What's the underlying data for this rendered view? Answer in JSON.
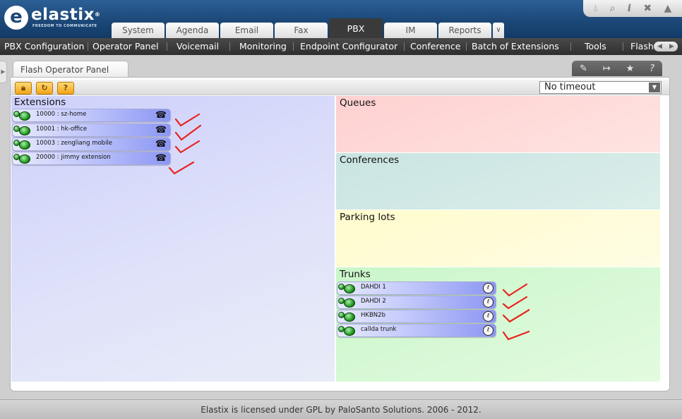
{
  "brand": {
    "logo_mark": "e",
    "name": "elastix",
    "registered": "®",
    "tagline": "FREEDOM TO COMMUNICATE"
  },
  "top_icons": [
    "drop-icon",
    "search-icon",
    "info-icon",
    "puzzle-icon",
    "user-icon"
  ],
  "tabs": [
    {
      "label": "System",
      "active": false
    },
    {
      "label": "Agenda",
      "active": false
    },
    {
      "label": "Email",
      "active": false
    },
    {
      "label": "Fax",
      "active": false
    },
    {
      "label": "PBX",
      "active": true
    },
    {
      "label": "IM",
      "active": false
    },
    {
      "label": "Reports",
      "active": false
    }
  ],
  "subnav": [
    "PBX Configuration",
    "Operator Panel",
    "Voicemail",
    "Monitoring",
    "Endpoint Configurator",
    "Conference",
    "Batch of Extensions",
    "Tools",
    "Flash"
  ],
  "module": {
    "title": "Flash Operator Panel"
  },
  "toolbar": {
    "timeout_value": "No timeout"
  },
  "panels": {
    "extensions": {
      "title": "Extensions",
      "items": [
        "10000 : sz-home",
        "10001 : hk-office",
        "10003 : zengliang mobile",
        "20000 : jimmy extension"
      ]
    },
    "queues": {
      "title": "Queues"
    },
    "conferences": {
      "title": "Conferences"
    },
    "parking": {
      "title": "Parking lots"
    },
    "trunks": {
      "title": "Trunks",
      "items": [
        "DAHDI 1",
        "DAHDI 2",
        "HKBN2b",
        "callda trunk"
      ]
    }
  },
  "annotation_color": "#e8231d",
  "footer": {
    "text": "Elastix is licensed under GPL by PaloSanto Solutions. 2006 - 2012."
  }
}
